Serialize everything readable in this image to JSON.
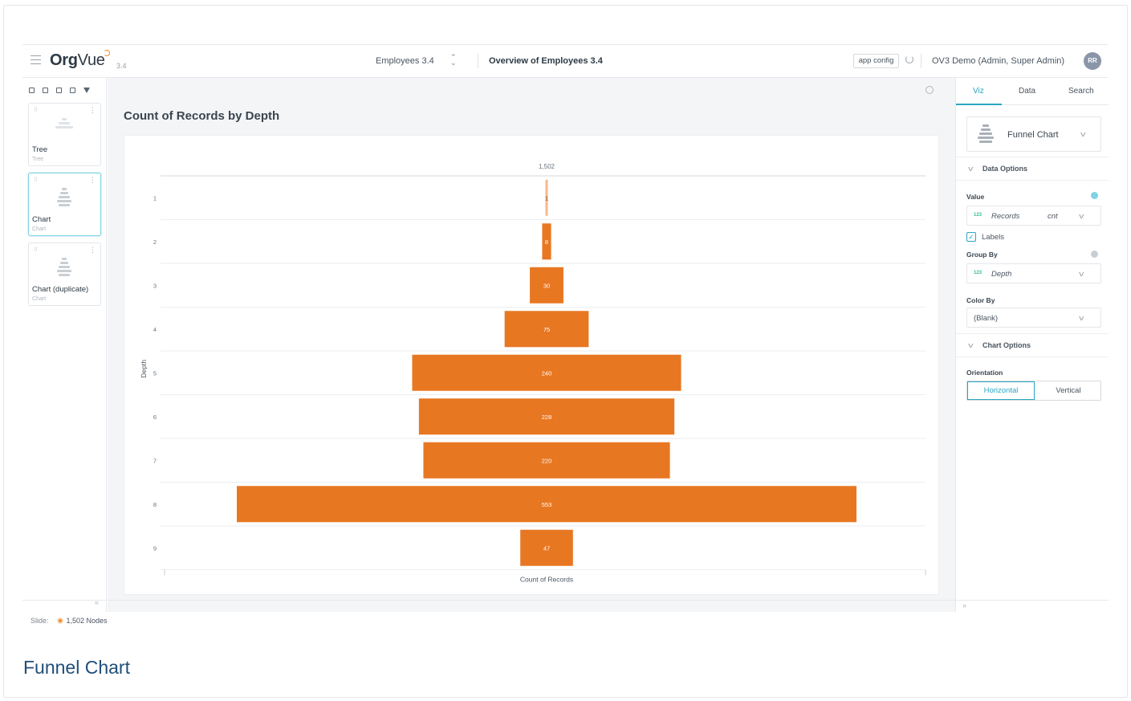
{
  "header": {
    "logo_org": "Org",
    "logo_vue": "Vue",
    "version": "3.4",
    "dataset": "Employees 3.4",
    "dataset_arrows": "⌃⌄",
    "page_name": "Overview of Employees 3.4",
    "app_config_label": "app config",
    "user": "OV3 Demo (Admin, Super Admin)",
    "avatar_initials": "RR"
  },
  "left_panel": {
    "cards": [
      {
        "title": "Tree",
        "subtitle": "Tree",
        "active": false
      },
      {
        "title": "Chart",
        "subtitle": "Chart",
        "active": true
      },
      {
        "title": "Chart (duplicate)",
        "subtitle": "Chart",
        "active": false
      }
    ],
    "collapse_icon": "«"
  },
  "main": {
    "viz_title": "Count of Records by Depth"
  },
  "chart_data": {
    "type": "bar",
    "subtype": "funnel",
    "orientation": "horizontal",
    "categories": [
      "1",
      "2",
      "3",
      "4",
      "5",
      "6",
      "7",
      "8",
      "9"
    ],
    "values": [
      1,
      8,
      30,
      75,
      240,
      228,
      220,
      553,
      47
    ],
    "total_label": "1,502",
    "xlabel": "Count of Records",
    "ylabel": "Depth",
    "bar_color": "#e87722",
    "first_bar_color": "#f6b98a"
  },
  "right_panel": {
    "tabs": [
      "Viz",
      "Data",
      "Search"
    ],
    "active_tab": "Viz",
    "chart_type": "Funnel Chart",
    "data_options_label": "Data Options",
    "value_label": "Value",
    "value_field_tag": "123",
    "value_field": "Records",
    "value_agg": "cnt",
    "labels_checkbox": "Labels",
    "labels_checked": true,
    "group_by_label": "Group By",
    "group_by_tag": "123",
    "group_by_field": "Depth",
    "color_by_label": "Color By",
    "color_by_value": "(Blank)",
    "chart_options_label": "Chart Options",
    "orientation_label": "Orientation",
    "orientation_options": [
      "Horizontal",
      "Vertical"
    ],
    "orientation_selected": "Horizontal",
    "expand_icon": "»"
  },
  "footer": {
    "slide_label": "Slide:",
    "nodes": "1,502 Nodes"
  },
  "caption": "Funnel Chart",
  "colors": {
    "accent": "#2aa6c2",
    "brand_orange": "#e87722",
    "caption_blue": "#1f4e79"
  }
}
